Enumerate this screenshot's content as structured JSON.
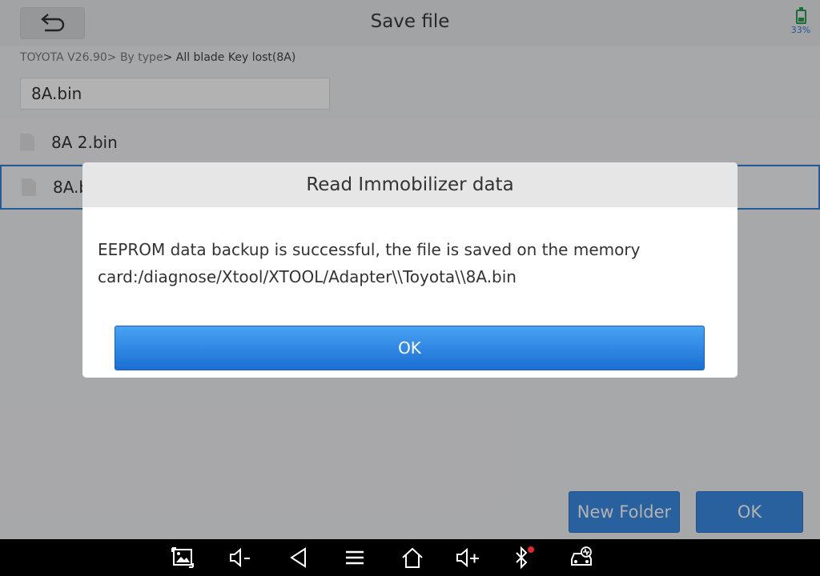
{
  "header": {
    "title": "Save file",
    "battery": "33%"
  },
  "breadcrumb": {
    "items": [
      "TOYOTA V26.90",
      "> By type",
      "> All blade Key lost(8A)"
    ]
  },
  "filename_input": {
    "value": "8A.bin"
  },
  "files": [
    {
      "name": "8A 2.bin",
      "selected": false
    },
    {
      "name": "8A.bin",
      "selected": true
    }
  ],
  "buttons": {
    "new_folder": "New Folder",
    "ok": "OK"
  },
  "dialog": {
    "title": "Read Immobilizer data",
    "message": "EEPROM data backup is successful, the file is saved on the memory card:/diagnose/Xtool/XTOOL/Adapter\\\\Toyota\\\\8A.bin",
    "ok": "OK"
  },
  "colors": {
    "accent": "#3c8ae2",
    "dialog_button": "#1a6fd2",
    "selection_border": "#3a82d8"
  },
  "navbar": {
    "icons": [
      "screenshot-icon",
      "volume-down-icon",
      "back-icon",
      "menu-icon",
      "home-icon",
      "volume-up-icon",
      "bluetooth-icon",
      "vehicle-diagnostic-icon"
    ]
  }
}
